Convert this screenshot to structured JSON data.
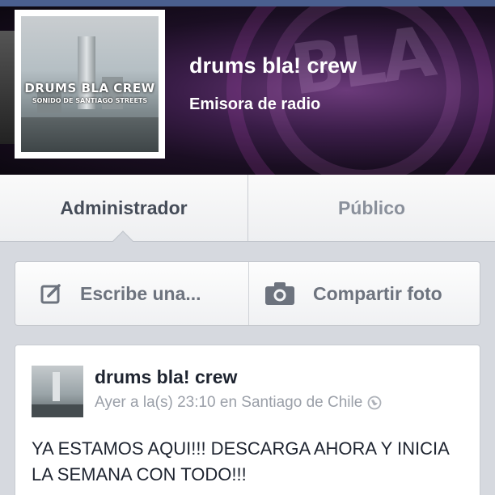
{
  "page": {
    "name": "drums bla! crew",
    "category": "Emisora de radio",
    "profile_logo_title": "DRUMS BLA CREW",
    "profile_logo_subtitle": "SONIDO DE SANTIAGO STREETS"
  },
  "tabs": {
    "admin_label": "Administrador",
    "public_label": "Público"
  },
  "composer": {
    "write_label": "Escribe una...",
    "write_icon": "compose-icon",
    "photo_label": "Compartir foto",
    "photo_icon": "camera-icon"
  },
  "post": {
    "author": "drums bla! crew",
    "meta": "Ayer a la(s) 23:10 en Santiago de Chile",
    "privacy_icon": "globe-icon",
    "text": "YA ESTAMOS AQUI!!! DESCARGA AHORA Y INICIA LA SEMANA CON TODO!!!"
  },
  "colors": {
    "topbar": "#4a5f8f",
    "background": "#d6d9df",
    "tab_active_text": "#454c58",
    "tab_inactive_text": "#8a909b",
    "composer_text": "#6d737e",
    "meta_text": "#9a9fa8"
  }
}
